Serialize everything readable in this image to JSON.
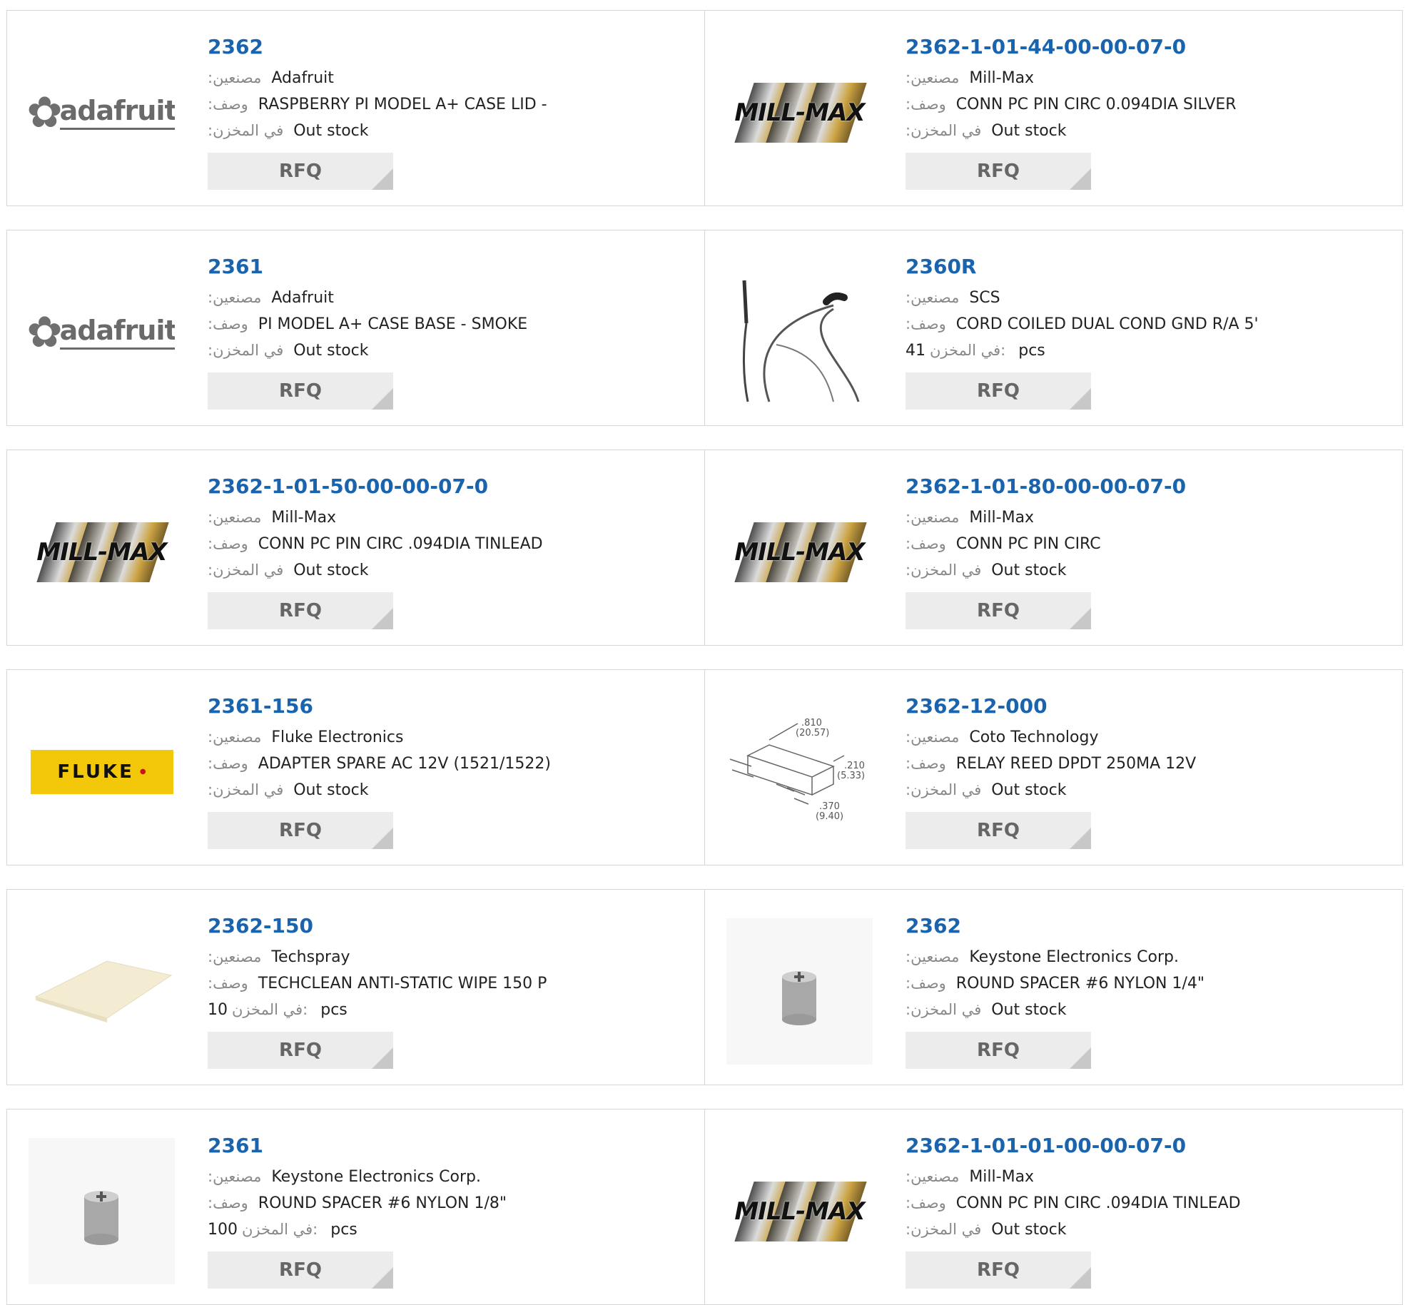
{
  "labels": {
    "manufacturer": ":مصنعين",
    "description": ":وصف",
    "stock": ":في المخزن",
    "stock_inline": "في المخزن:",
    "rfq": "RFQ",
    "pcs": "pcs"
  },
  "products": [
    {
      "part": "2362",
      "manufacturer": "Adafruit",
      "description": "RASPBERRY PI MODEL A+ CASE LID -",
      "stock": "Out stock",
      "image": "adafruit-logo"
    },
    {
      "part": "2362-1-01-44-00-00-07-0",
      "manufacturer": "Mill-Max",
      "description": "CONN PC PIN CIRC 0.094DIA SILVER",
      "stock": "Out stock",
      "image": "mill-max-logo"
    },
    {
      "part": "2361",
      "manufacturer": "Adafruit",
      "description": "PI MODEL A+ CASE BASE - SMOKE",
      "stock": "Out stock",
      "image": "adafruit-logo"
    },
    {
      "part": "2360R",
      "manufacturer": "SCS",
      "description": "CORD COILED DUAL COND GND R/A 5'",
      "stock_qty": "41",
      "image": "coiled-cord-photo"
    },
    {
      "part": "2362-1-01-50-00-00-07-0",
      "manufacturer": "Mill-Max",
      "description": "CONN PC PIN CIRC .094DIA TINLEAD",
      "stock": "Out stock",
      "image": "mill-max-logo"
    },
    {
      "part": "2362-1-01-80-00-00-07-0",
      "manufacturer": "Mill-Max",
      "description": "CONN PC PIN CIRC",
      "stock": "Out stock",
      "image": "mill-max-logo"
    },
    {
      "part": "2361-156",
      "manufacturer": "Fluke Electronics",
      "description": "ADAPTER SPARE AC 12V (1521/1522)",
      "stock": "Out stock",
      "image": "fluke-logo"
    },
    {
      "part": "2362-12-000",
      "manufacturer": "Coto Technology",
      "description": "RELAY REED DPDT 250MA 12V",
      "stock": "Out stock",
      "image": "reed-relay-drawing"
    },
    {
      "part": "2362-150",
      "manufacturer": "Techspray",
      "description": "TECHCLEAN ANTI-STATIC WIPE 150 P",
      "stock_qty": "10",
      "image": "wipe-photo"
    },
    {
      "part": "2362",
      "manufacturer": "Keystone Electronics Corp.",
      "description": "ROUND SPACER #6 NYLON 1/4\"",
      "stock": "Out stock",
      "image": "spacer-photo"
    },
    {
      "part": "2361",
      "manufacturer": "Keystone Electronics Corp.",
      "description": "ROUND SPACER #6 NYLON 1/8\"",
      "stock_qty": "100",
      "image": "spacer-photo"
    },
    {
      "part": "2362-1-01-01-00-00-07-0",
      "manufacturer": "Mill-Max",
      "description": "CONN PC PIN CIRC .094DIA TINLEAD",
      "stock": "Out stock",
      "image": "mill-max-logo"
    }
  ],
  "drawing": {
    "dim1": ".810",
    "dim1_mm": "(20.57)",
    "dim2": ".210",
    "dim2_mm": "(5.33)",
    "dim3": ".370",
    "dim3_mm": "(9.40)"
  },
  "colors": {
    "link": "#1a63ad",
    "fluke_yellow": "#f4c80a",
    "rfq_bg": "#ececec"
  }
}
